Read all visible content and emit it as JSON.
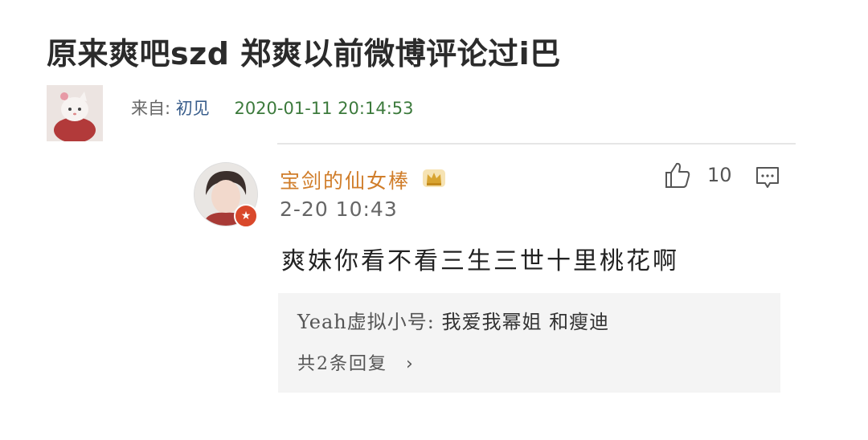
{
  "post": {
    "title": "原来爽吧szd 郑爽以前微博评论过i巴",
    "source_label": "来自:",
    "source_name": "初见",
    "date": "2020-01-11 20:14:53"
  },
  "comment": {
    "username": "宝剑的仙女棒",
    "time": "2-20 10:43",
    "like_count": "10",
    "text": "爽妹你看不看三生三世十里桃花啊",
    "reply": {
      "name": "Yeah虚拟小号:",
      "text": "我爱我幂姐 和瘦迪",
      "more": "共2条回复",
      "chevron": "›"
    }
  },
  "colors": {
    "username": "#d07d2a",
    "date": "#3c7a3c",
    "source": "#3a5e8c",
    "badge": "#d9482b"
  },
  "icons": [
    "like-icon",
    "reply-icon",
    "crown-icon",
    "verified-badge-icon"
  ]
}
